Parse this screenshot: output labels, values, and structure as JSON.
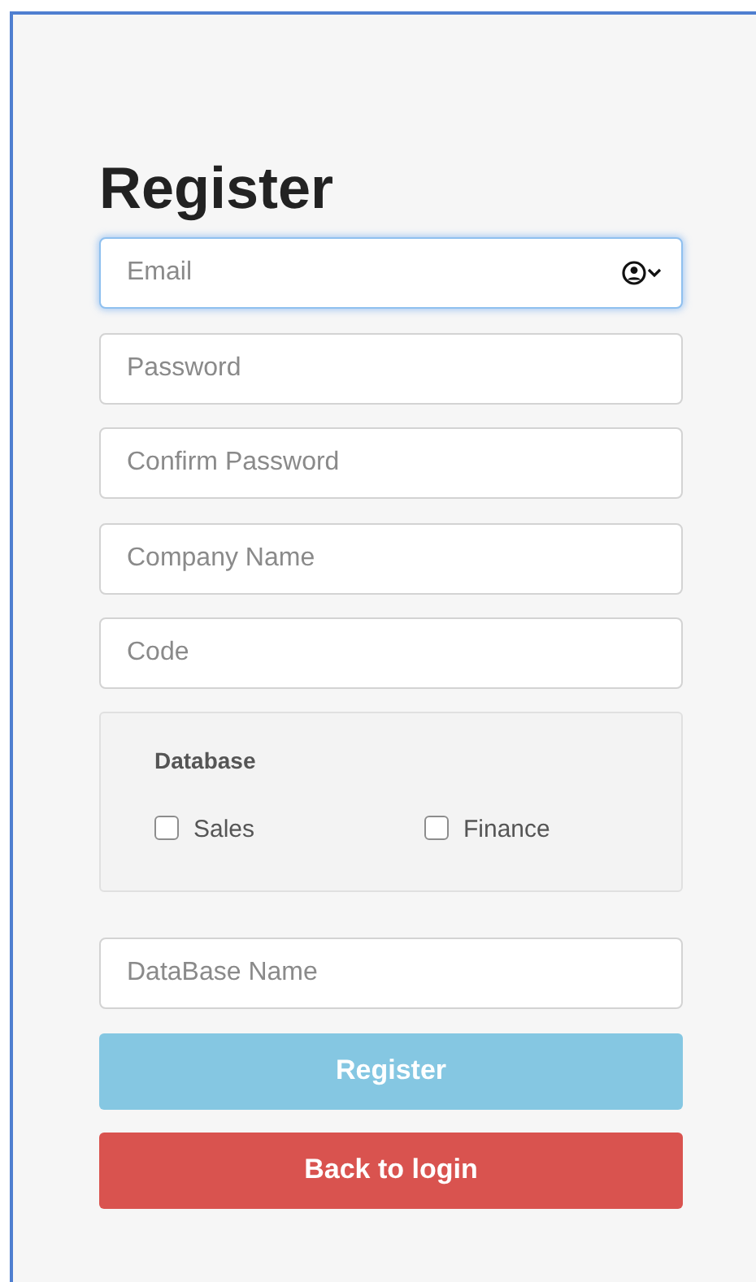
{
  "title": "Register",
  "fields": [
    {
      "placeholder": "Email",
      "kind": "email",
      "focused": true
    },
    {
      "placeholder": "Password",
      "kind": "password",
      "focused": false
    },
    {
      "placeholder": "Confirm Password",
      "kind": "password",
      "focused": false
    },
    {
      "placeholder": "Company Name",
      "kind": "text",
      "focused": false
    },
    {
      "placeholder": "Code",
      "kind": "text",
      "focused": false
    }
  ],
  "database": {
    "label": "Database",
    "options": [
      {
        "label": "Sales",
        "checked": false
      },
      {
        "label": "Finance",
        "checked": false
      }
    ]
  },
  "database_name": {
    "placeholder": "DataBase Name"
  },
  "buttons": [
    {
      "label": "Register",
      "kind": "primary"
    },
    {
      "label": "Back to login",
      "kind": "danger"
    }
  ]
}
